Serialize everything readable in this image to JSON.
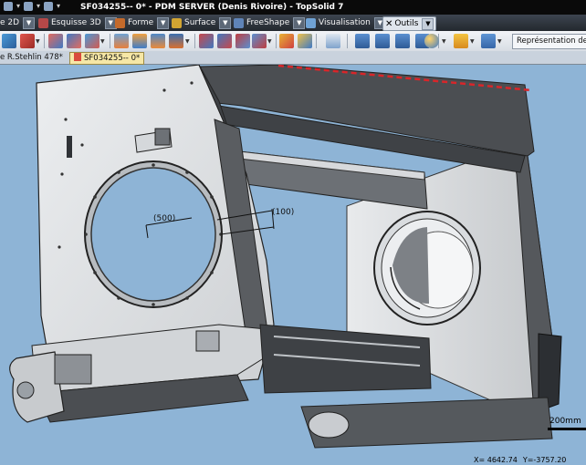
{
  "window": {
    "title": "SF034255-- 0* - PDM SERVER (Denis Rivoire) - TopSolid 7"
  },
  "menu_tabs": [
    {
      "label": "e 2D"
    },
    {
      "label": "Esquisse 3D"
    },
    {
      "label": "Forme"
    },
    {
      "label": "Surface"
    },
    {
      "label": "FreeShape"
    },
    {
      "label": "Visualisation"
    },
    {
      "label": "Outils"
    }
  ],
  "toolbar": {
    "representation_label": "Représentation de"
  },
  "document_tabs": [
    {
      "label": "e R.Stehlin 478*"
    },
    {
      "label": "SF034255-- 0*"
    }
  ],
  "viewport": {
    "dimension_labels": [
      "(500)",
      "(100)"
    ],
    "scale_label": "200mm",
    "coords": {
      "x": "X= 4642.74",
      "y": "Y=-3757.20"
    }
  },
  "colors": {
    "viewport_bg": "#8eb4d6",
    "part_light": "#e2e4e6",
    "part_dark": "#4b4e52",
    "accent_red": "#d8262a"
  }
}
